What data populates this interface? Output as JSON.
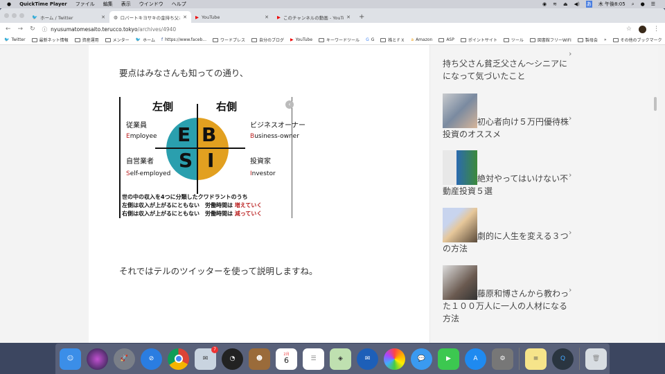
{
  "menubar": {
    "app": "QuickTime Player",
    "items": [
      "ファイル",
      "編集",
      "表示",
      "ウインドウ",
      "ヘルプ"
    ],
    "clock": "木 午後8:05"
  },
  "tabs": [
    {
      "label": "ホーム / Twitter",
      "icon": "twitter-icon"
    },
    {
      "label": "ロバートキヨサキの金持ち父さん貧乏父さん",
      "icon": "globe-icon"
    },
    {
      "label": "YouTube",
      "icon": "youtube-icon"
    },
    {
      "label": "このチャンネルの動画 - YouTube",
      "icon": "youtube-icon"
    }
  ],
  "address": {
    "host": "nyusumatomesaito.terucco.tokyo",
    "path": "/archives/4940"
  },
  "bookmarks": [
    "Twitter",
    "最新ネット情報",
    "資産運用",
    "メンター",
    "ホーム",
    "https://www.faceb...",
    "ワードプレス",
    "自分のブログ",
    "YouTube",
    "キーワードツール",
    "G",
    "株とＦＸ",
    "Amazon",
    "ASP",
    "ポイントサイト",
    "ツール",
    "図書館フリーWIFI",
    "製母会"
  ],
  "bookmarks_more": "»",
  "bookmarks_other": "その他のブックマーク",
  "article": {
    "para1": "要点はみなさんも知っての通り、",
    "para2": "それではテルのツイッターを使って説明しますね。",
    "figure": {
      "left": "左側",
      "right": "右側",
      "e_jp": "従業員",
      "e_en_first": "E",
      "e_en_rest": "mployee",
      "b_jp": "ビジネスオーナー",
      "b_en_first": "B",
      "b_en_rest": "usiness-owner",
      "s_jp": "自営業者",
      "s_en_first": "S",
      "s_en_rest": "elf-employed",
      "i_jp": "投資家",
      "i_en_first": "I",
      "i_en_rest": "nvestor",
      "letters": [
        "E",
        "B",
        "S",
        "I"
      ],
      "line1": "世の中の収入を4つに分類したクワドラントのうち",
      "line2": "左側は収入が上がるにともない　労働時間は",
      "line2_red": "増えていく",
      "line3": "右側は収入が上がるにともない　労働時間は",
      "line3_red": "減っていく",
      "colors": {
        "left": "#2a9fae",
        "right": "#e2a020"
      }
    }
  },
  "sidebar": {
    "posts": [
      {
        "title": "ロバートキヨサキの金持ち父さん貧乏父さん〜シニアにになって気づいたこと",
        "visible": "持ち父さん貧乏父さん〜シニアにになって気づいたこと"
      },
      {
        "title": "初心者向け５万円優待株投資のオススメ"
      },
      {
        "title": "絶対やってはいけない不動産投資５選"
      },
      {
        "title": "劇的に人生を変える３つの方法"
      },
      {
        "title": "藤原和博さんから教わった１００万人に一人の人材になる方法"
      }
    ]
  },
  "dock": {
    "apps": [
      "Finder",
      "Siri",
      "Launchpad",
      "Safari",
      "Chrome",
      "Mail",
      "Dashboard",
      "Contacts",
      "Calendar",
      "Reminders",
      "Maps",
      "Thunderbird",
      "Photos",
      "Messages",
      "FaceTime",
      "App Store",
      "System Preferences",
      "Notes",
      "QuickTime Player",
      "Trash"
    ],
    "mail_badge": "7",
    "calendar_month": "2月",
    "calendar_day": "6"
  }
}
